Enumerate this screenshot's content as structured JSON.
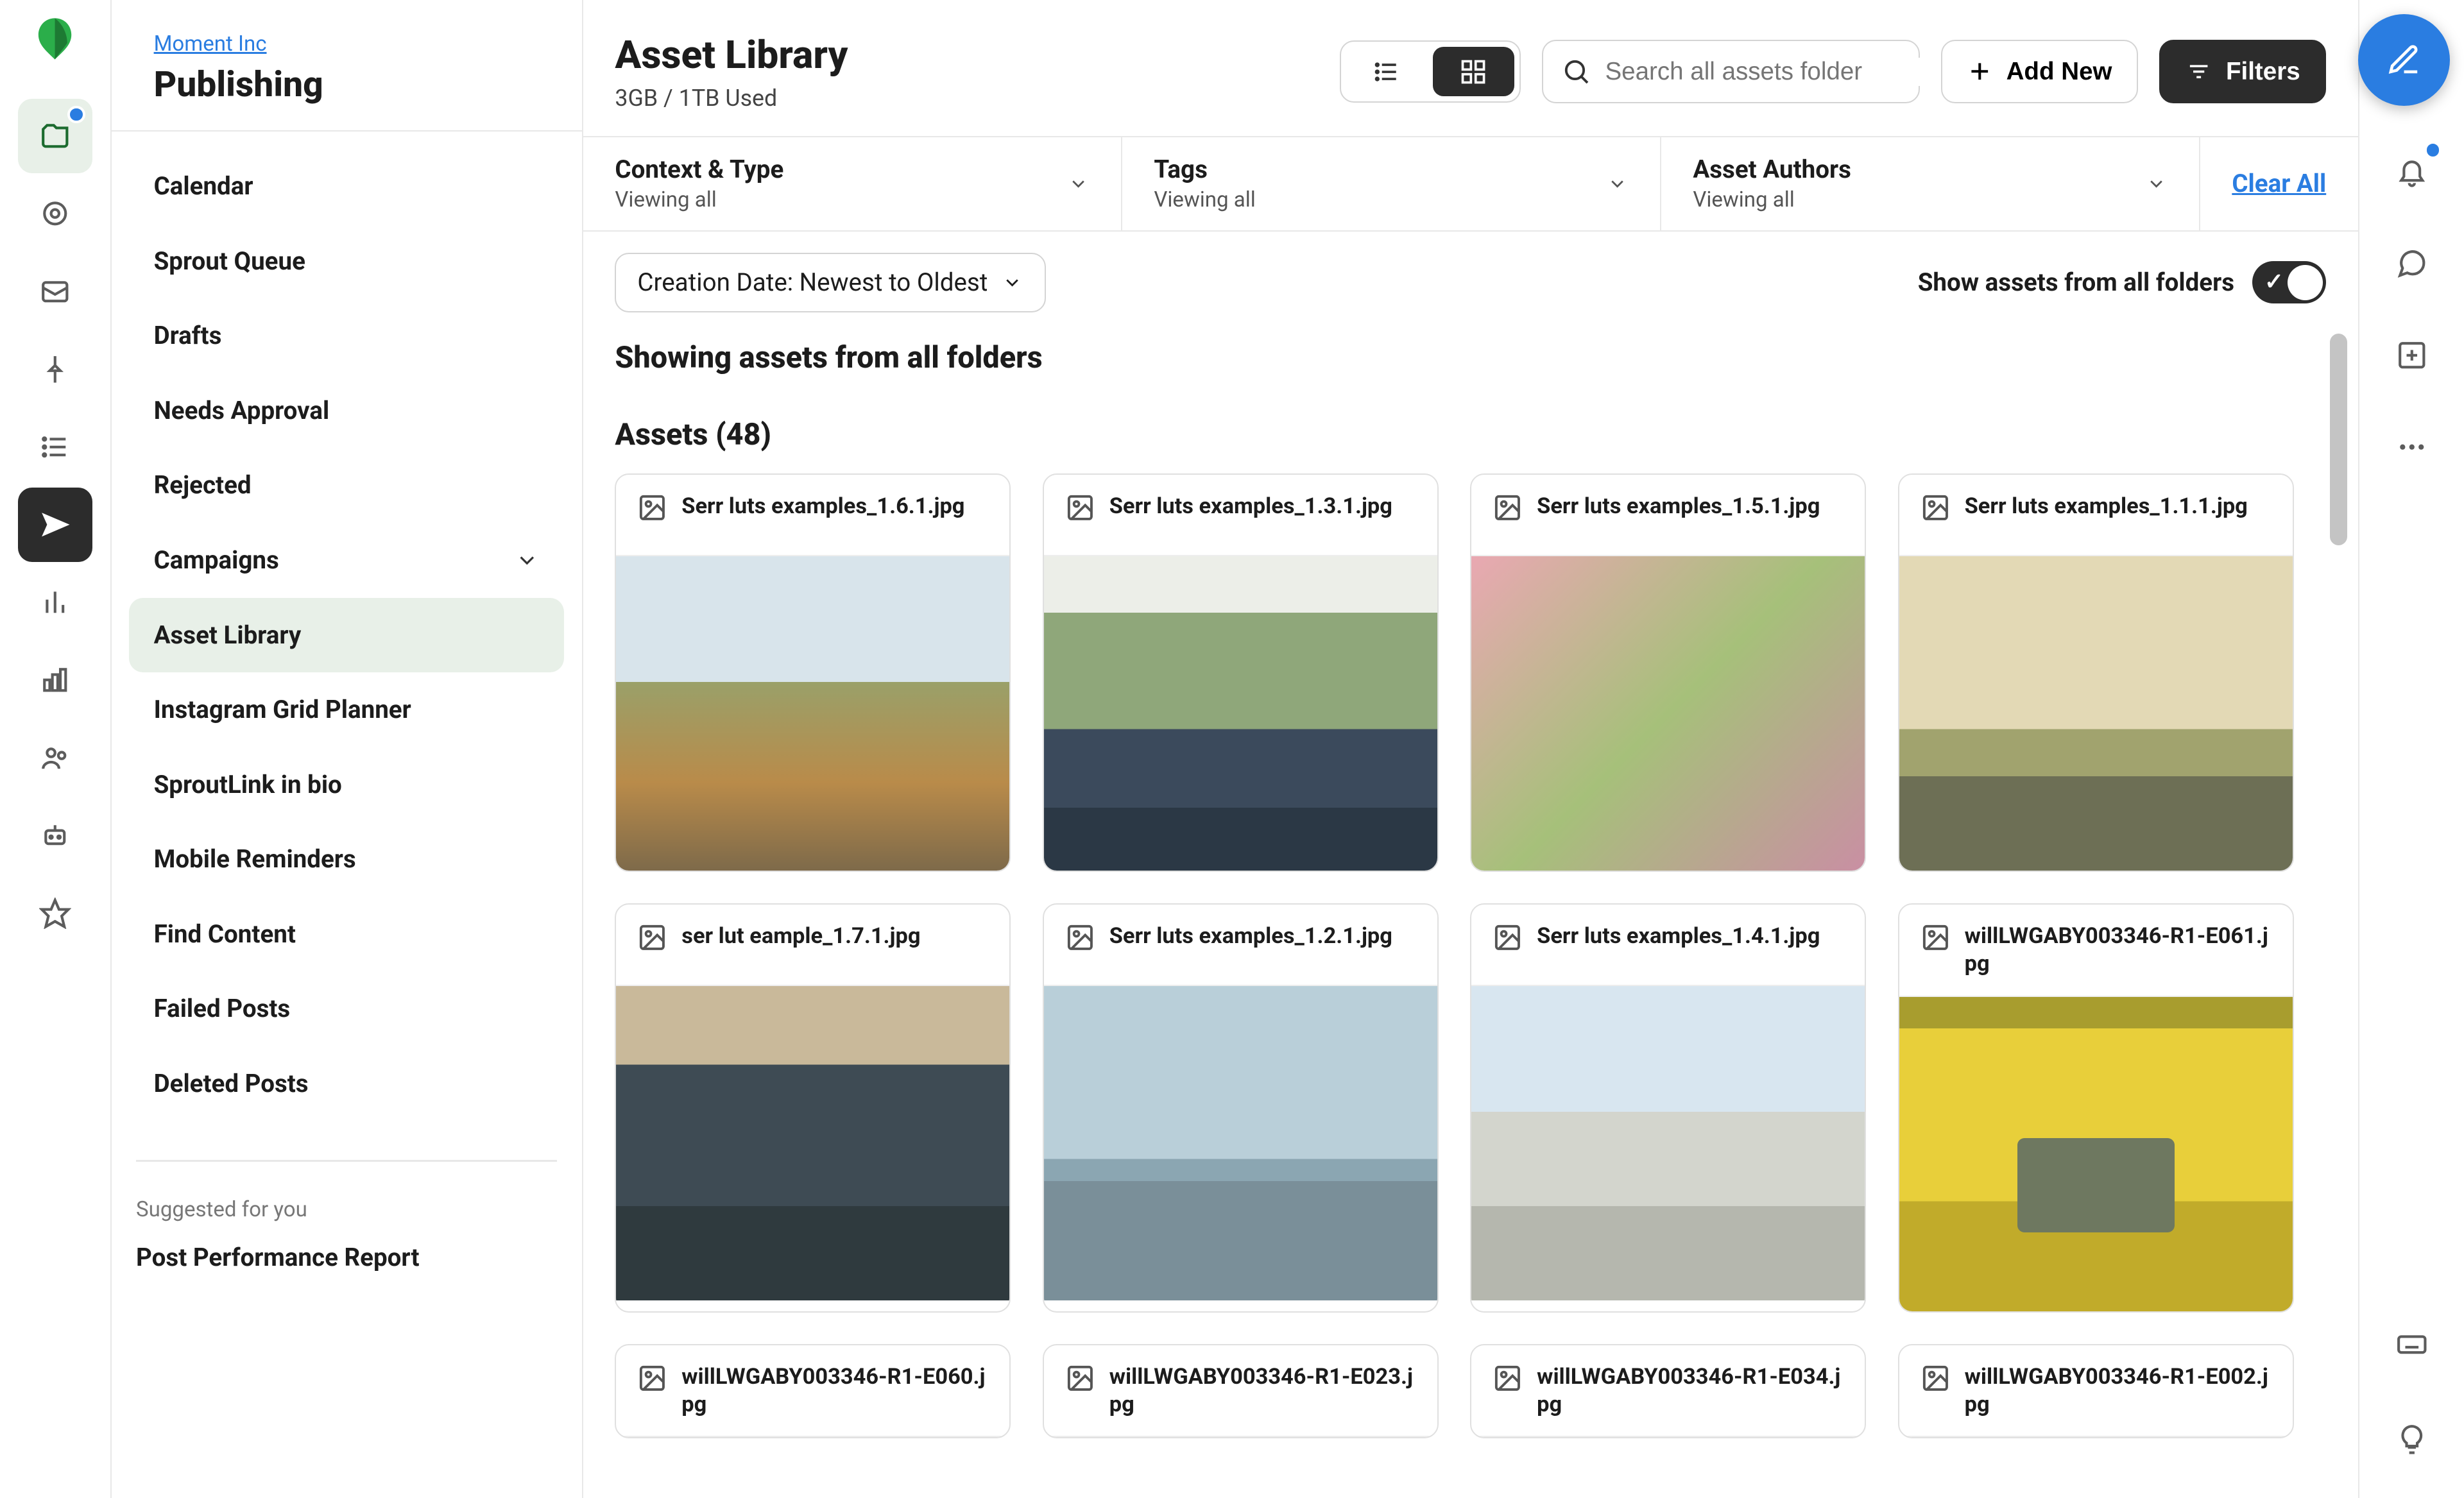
{
  "breadcrumb": "Moment Inc",
  "section_title": "Publishing",
  "sidebar": {
    "items": [
      {
        "label": "Calendar"
      },
      {
        "label": "Sprout Queue"
      },
      {
        "label": "Drafts"
      },
      {
        "label": "Needs Approval"
      },
      {
        "label": "Rejected"
      },
      {
        "label": "Campaigns",
        "expandable": true
      },
      {
        "label": "Asset Library",
        "active": true
      },
      {
        "label": "Instagram Grid Planner"
      },
      {
        "label": "SproutLink in bio"
      },
      {
        "label": "Mobile Reminders"
      },
      {
        "label": "Find Content"
      },
      {
        "label": "Failed Posts"
      },
      {
        "label": "Deleted Posts"
      }
    ],
    "suggested_label": "Suggested for you",
    "suggested_item": "Post Performance Report"
  },
  "header": {
    "title": "Asset Library",
    "usage": "3GB / 1TB Used",
    "search_placeholder": "Search all assets folder",
    "add_new": "Add New",
    "filters": "Filters"
  },
  "filters": {
    "context": {
      "label": "Context & Type",
      "sub": "Viewing all"
    },
    "tags": {
      "label": "Tags",
      "sub": "Viewing all"
    },
    "authors": {
      "label": "Asset Authors",
      "sub": "Viewing all"
    },
    "clear": "Clear All"
  },
  "sort": {
    "label": "Creation Date: Newest to Oldest",
    "folders_label": "Show assets from all folders"
  },
  "showing": "Showing assets from all folders",
  "assets_heading": "Assets (48)",
  "assets": [
    {
      "name": "Serr luts examples_1.6.1.jpg",
      "thumb": "th1"
    },
    {
      "name": "Serr luts examples_1.3.1.jpg",
      "thumb": "th2"
    },
    {
      "name": "Serr luts examples_1.5.1.jpg",
      "thumb": "th3"
    },
    {
      "name": "Serr luts examples_1.1.1.jpg",
      "thumb": "th4"
    },
    {
      "name": "ser lut eample_1.7.1.jpg",
      "thumb": "th5"
    },
    {
      "name": "Serr luts examples_1.2.1.jpg",
      "thumb": "th6"
    },
    {
      "name": "Serr luts examples_1.4.1.jpg",
      "thumb": "th7"
    },
    {
      "name": "willLWGABY003346-R1-E061.jpg",
      "thumb": "th8"
    },
    {
      "name": "willLWGABY003346-R1-E060.jpg",
      "thumb": ""
    },
    {
      "name": "willLWGABY003346-R1-E023.jpg",
      "thumb": ""
    },
    {
      "name": "willLWGABY003346-R1-E034.jpg",
      "thumb": ""
    },
    {
      "name": "willLWGABY003346-R1-E002.jpg",
      "thumb": ""
    }
  ],
  "icons": {
    "folder": "folder-icon",
    "send": "send-icon"
  }
}
